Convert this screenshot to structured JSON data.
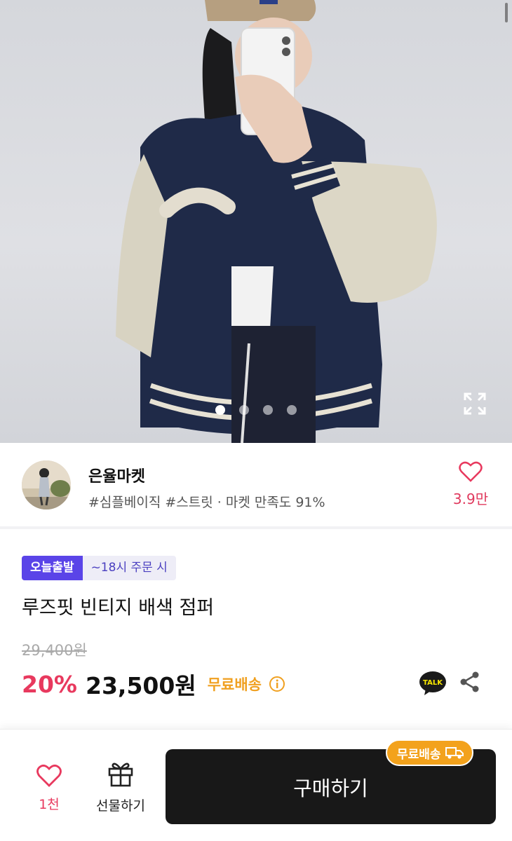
{
  "hero": {
    "image_description_icon": "product-photo",
    "carousel_total": 4,
    "carousel_active_index": 0
  },
  "seller": {
    "name": "은율마켓",
    "tags": "#심플베이직 #스트릿 · 마켓 만족도 91%",
    "like_count": "3.9만"
  },
  "product": {
    "badge_main": "오늘출발",
    "badge_sub": "~18시 주문 시",
    "title": "루즈핏 빈티지 배색 점퍼",
    "original_price": "29,400원",
    "discount": "20%",
    "price": "23,500원",
    "free_shipping": "무료배송"
  },
  "bottom_bar": {
    "wish_count": "1천",
    "gift_label": "선물하기",
    "buy_label": "구매하기",
    "shipping_pill": "무료배송"
  },
  "colors": {
    "accent_pink": "#e8395e",
    "badge_purple": "#5a44e8",
    "shipping_orange": "#f0a020",
    "buy_button": "#181818"
  }
}
